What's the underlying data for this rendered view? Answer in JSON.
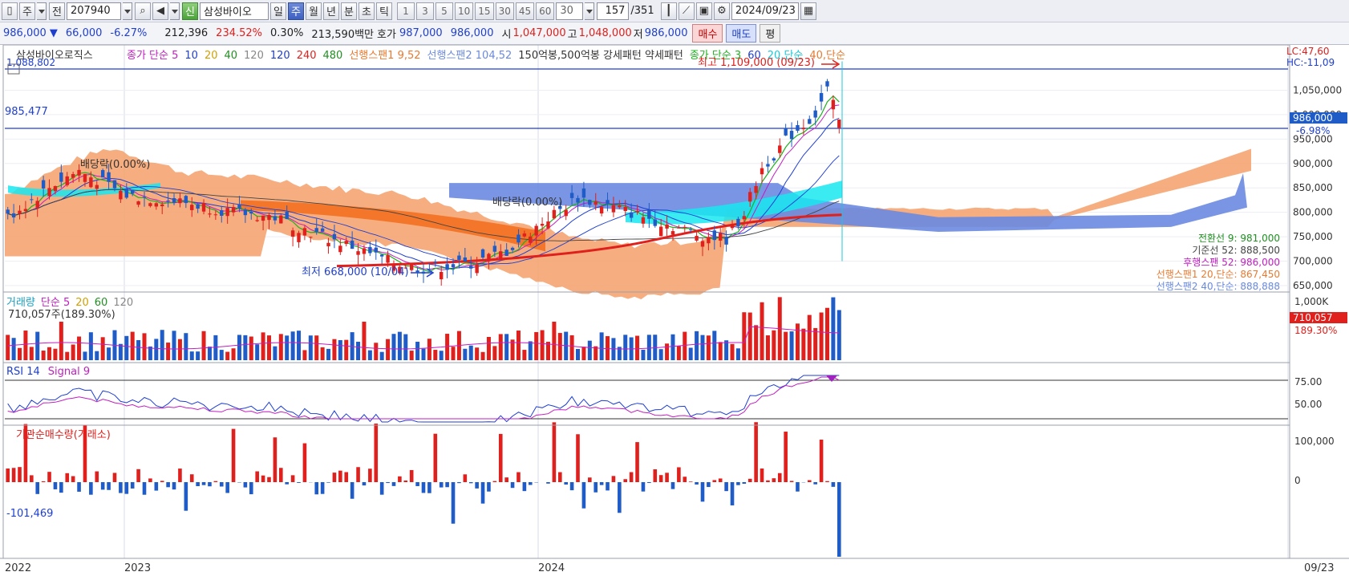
{
  "toolbar": {
    "period": "주",
    "scope": "전",
    "code": "207940",
    "badge": "신",
    "stock_name": "삼성바이오",
    "periods": [
      "일",
      "주",
      "월",
      "년",
      "분",
      "초",
      "틱"
    ],
    "selected_period": "주",
    "intervals": [
      "1",
      "3",
      "5",
      "10",
      "15",
      "30",
      "45",
      "60"
    ],
    "count": "30",
    "position": "157",
    "total": "/351",
    "date": "2024/09/23"
  },
  "quote": {
    "price": "986,000",
    "arrow": "▼",
    "change": "66,000",
    "pct": "-6.27%",
    "volume": "212,396",
    "vol_ratio": "234.52%",
    "turnover": "0.30%",
    "amount": "213,590백만",
    "hoga_label": "호가",
    "ask": "987,000",
    "bid": "986,000",
    "open_label": "시",
    "open": "1,047,000",
    "high_label": "고",
    "high": "1,048,000",
    "low_label": "저",
    "low": "986,000",
    "buy": "매수",
    "sell": "매도",
    "flat": "평"
  },
  "price_panel": {
    "title": "삼성바이오로직스",
    "legend": [
      {
        "text": "종가 단순 5",
        "color": "#c020c0"
      },
      {
        "text": "10",
        "color": "#1f3fd0"
      },
      {
        "text": "20",
        "color": "#d0a000"
      },
      {
        "text": "40",
        "color": "#209020"
      },
      {
        "text": "120",
        "color": "#888888"
      },
      {
        "text": "120",
        "color": "#2040c0"
      },
      {
        "text": "240",
        "color": "#e0201c"
      },
      {
        "text": "480",
        "color": "#209020"
      },
      {
        "text": "선행스팬1 9,52",
        "color": "#e87a30"
      },
      {
        "text": "선행스팬2 104,52",
        "color": "#6a8ae0"
      },
      {
        "text": "150억봉,500억봉 강세패턴 약세패턴",
        "color": "#333333"
      },
      {
        "text": "종가 단순 3",
        "color": "#20b020"
      },
      {
        "text": "60",
        "color": "#1f3fd0"
      },
      {
        "text": "20,단순",
        "color": "#18c8d8"
      },
      {
        "text": "40,단순",
        "color": "#e87a30"
      }
    ],
    "top_line_label": "1,088,802",
    "mid_line_label": "985,477",
    "max_label": "최고 1,109,000 (09/23)",
    "min_label": "최저 668,000 (10/04)",
    "dividend1": "배당락(0.00%)",
    "dividend2": "배당락(0.00%)",
    "lc": "LC:47,60",
    "hc": "HC:-11,09",
    "axis_ticks": [
      "1,050,000",
      "1,000,000",
      "950,000",
      "900,000",
      "850,000",
      "800,000",
      "750,000",
      "700,000",
      "650,000"
    ],
    "current_price": "986,000",
    "current_pct": "-6.98%",
    "indicators": [
      {
        "text": "전환선 9: 981,000",
        "color": "#209020"
      },
      {
        "text": "기준선 52: 888,500",
        "color": "#444444"
      },
      {
        "text": "후행스팬 52: 986,000",
        "color": "#c020c0"
      },
      {
        "text": "선행스팬1 20,단순: 867,450",
        "color": "#e87a30"
      },
      {
        "text": "선행스팬2 40,단순: 888,888",
        "color": "#6a8ae0"
      }
    ]
  },
  "volume_panel": {
    "legend": [
      {
        "text": "거래량",
        "color": "#18a0c0"
      },
      {
        "text": "단순 5",
        "color": "#c020c0"
      },
      {
        "text": "20",
        "color": "#d0a000"
      },
      {
        "text": "60",
        "color": "#209020"
      },
      {
        "text": "120",
        "color": "#888888"
      }
    ],
    "value_label": "710,057주(189.30%)",
    "axis_top": "1,000K",
    "current": "710,057",
    "current_pct": "189.30%"
  },
  "rsi_panel": {
    "legend": [
      {
        "text": "RSI 14",
        "color": "#1f3fd0"
      },
      {
        "text": "Signal 9",
        "color": "#c020c0"
      }
    ],
    "ticks": [
      "75.00",
      "50.00"
    ]
  },
  "inst_panel": {
    "title": "기관순매수량(거래소)",
    "ticks": [
      "100,000",
      "0"
    ],
    "min_label": "-101,469"
  },
  "time_axis": {
    "labels": [
      "2022",
      "2023",
      "2024"
    ],
    "end_label": "09/23"
  },
  "colors": {
    "up": "#e0201c",
    "down": "#1f5cc8",
    "cloud_up": "#f4a06a",
    "cloud_down": "#6a8ae0",
    "bg": "#ffffff"
  }
}
